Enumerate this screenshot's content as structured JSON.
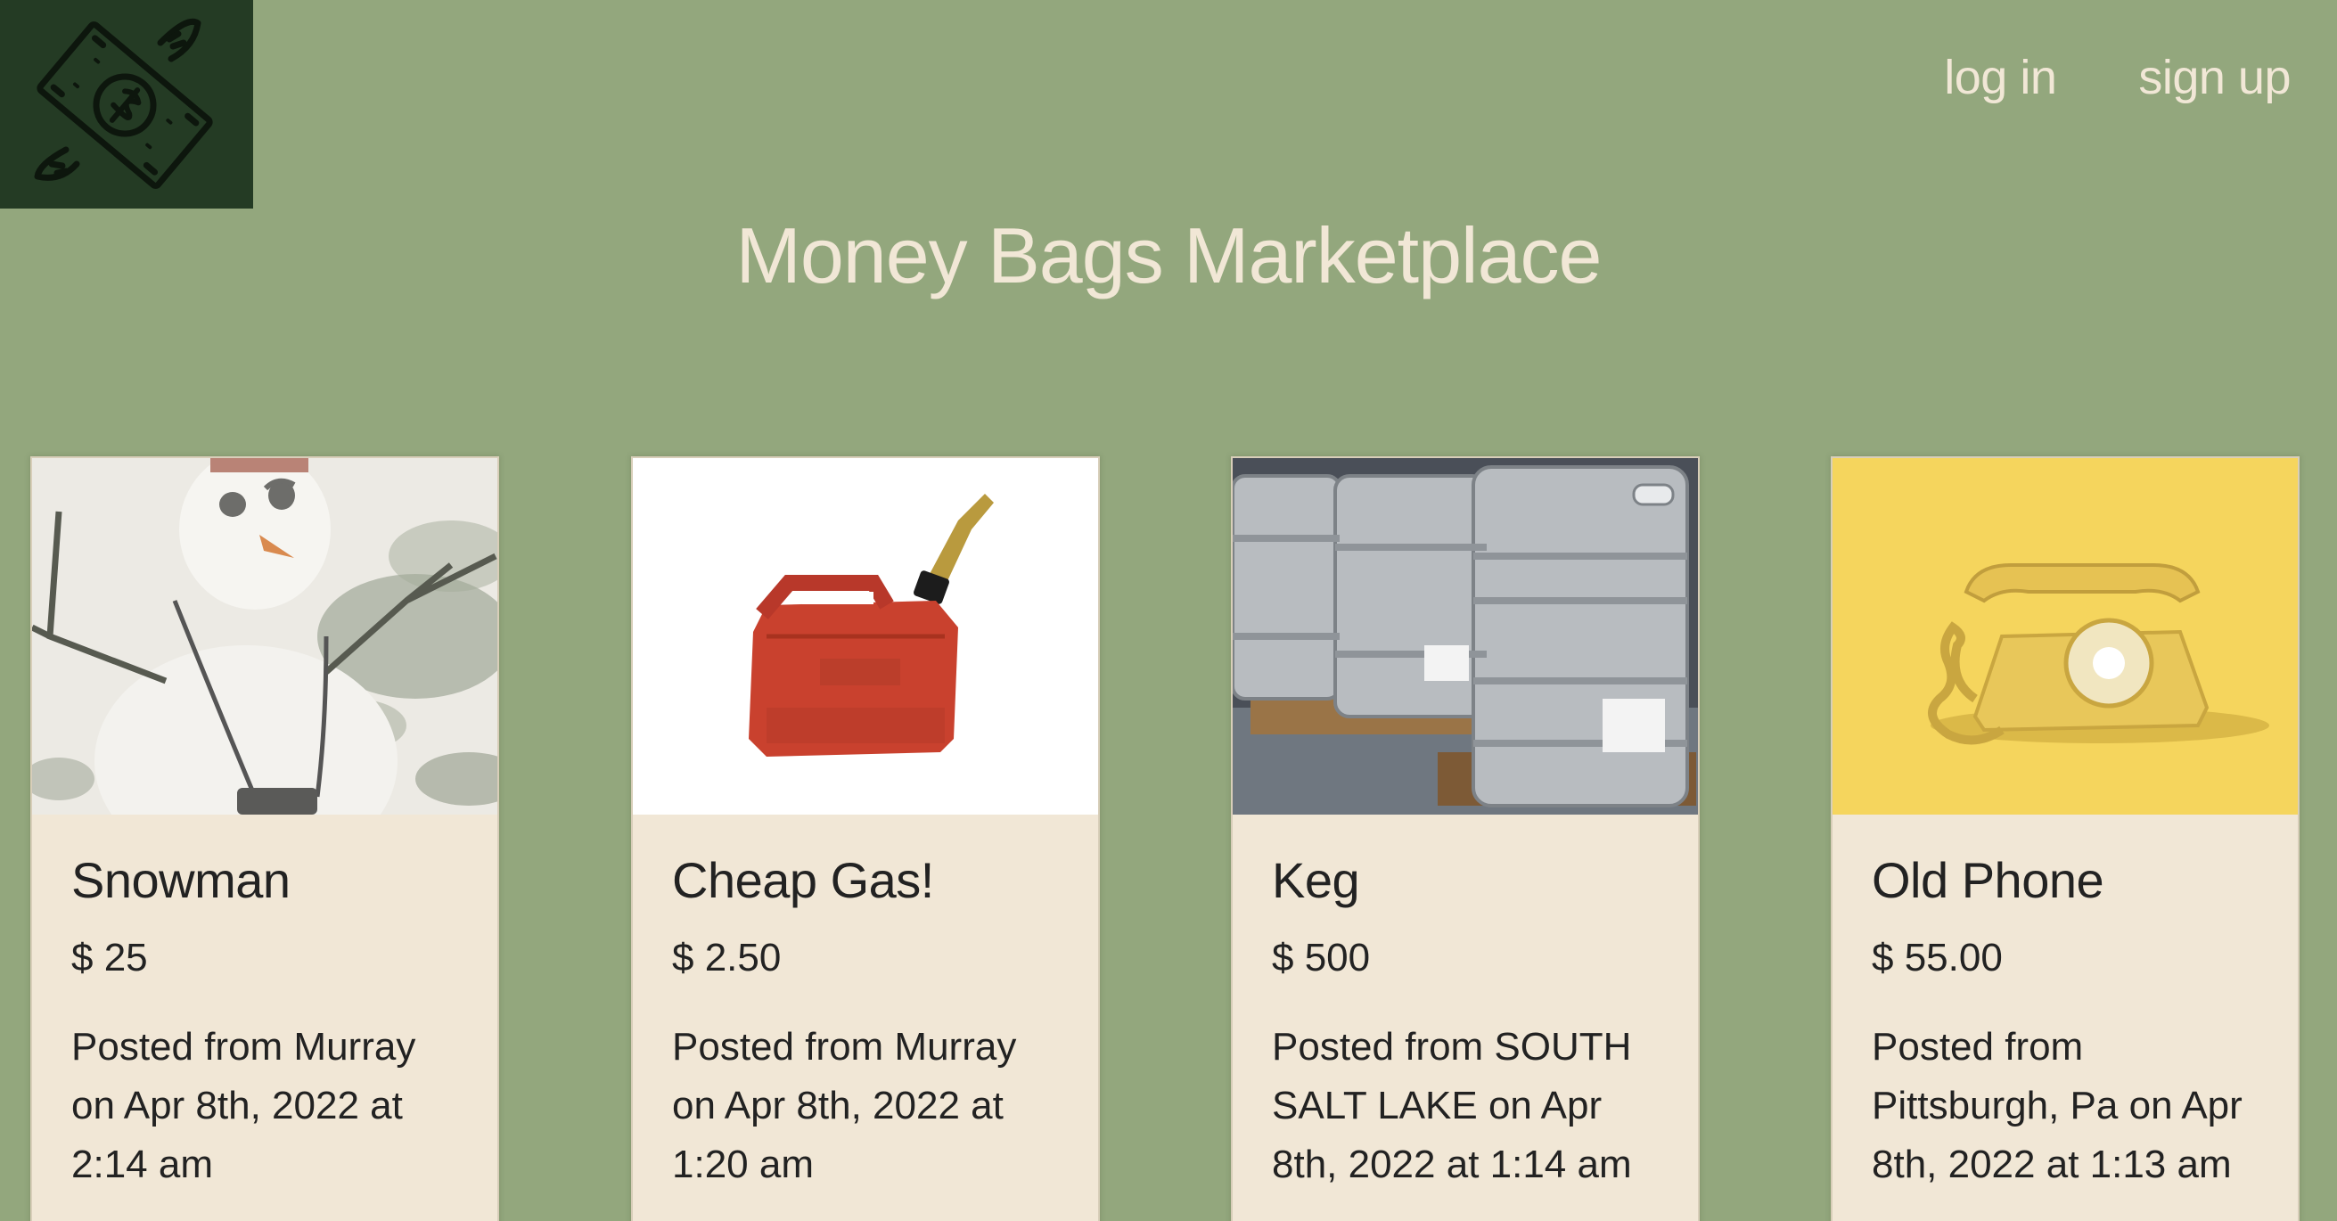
{
  "header": {
    "title": "Money Bags Marketplace",
    "nav": {
      "login_label": "log in",
      "signup_label": "sign up"
    },
    "logo_icon": "flying-money-icon"
  },
  "colors": {
    "background": "#93a77d",
    "logo_bg": "#243b24",
    "title_text": "#f1e7d6",
    "card_bg": "#f1e7d6"
  },
  "listings": [
    {
      "title": "Snowman",
      "price": "$ 25",
      "posted": "Posted from Murray on Apr 8th, 2022 at 2:14 am",
      "image": "snowman-photo"
    },
    {
      "title": "Cheap Gas!",
      "price": "$ 2.50",
      "posted": "Posted from Murray on Apr 8th, 2022 at 1:20 am",
      "image": "gas-can-photo"
    },
    {
      "title": "Keg",
      "price": "$ 500",
      "posted": "Posted from SOUTH SALT LAKE on Apr 8th, 2022 at 1:14 am",
      "image": "kegs-photo"
    },
    {
      "title": "Old Phone",
      "price": "$ 55.00",
      "posted": "Posted from Pittsburgh, Pa on Apr 8th, 2022 at 1:13 am",
      "image": "rotary-phone-photo"
    }
  ]
}
